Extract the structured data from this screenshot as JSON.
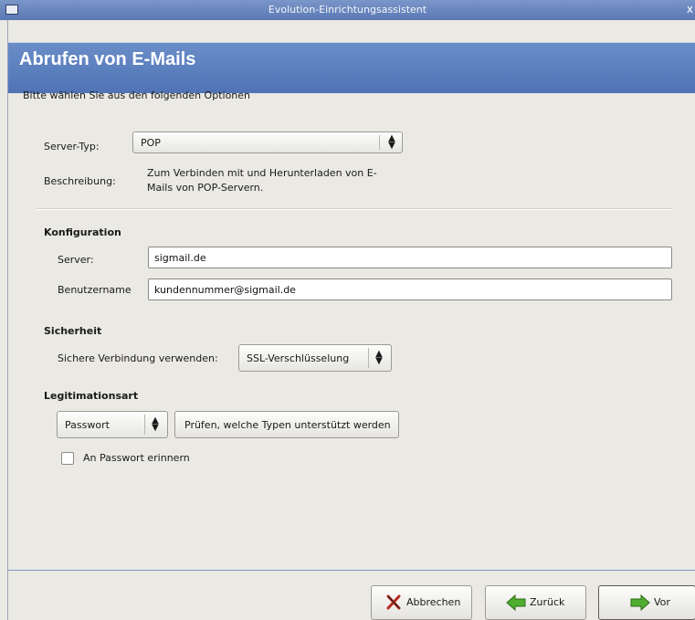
{
  "window": {
    "title": "Evolution-Einrichtungsassistent",
    "close_glyph": "x"
  },
  "header": {
    "title": "Abrufen von E-Mails"
  },
  "intro": "Bitte wählen Sie aus den folgenden Optionen",
  "server_type": {
    "label": "Server-Typ:",
    "value": "POP",
    "description_label": "Beschreibung:",
    "description": "Zum Verbinden mit und Herunterladen von E-Mails von POP-Servern."
  },
  "configuration": {
    "heading": "Konfiguration",
    "server_label": "Server:",
    "server_value": "sigmail.de",
    "username_label": "Benutzername",
    "username_value": "kundennummer@sigmail.de"
  },
  "security": {
    "heading": "Sicherheit",
    "label": "Sichere Verbindung verwenden:",
    "value": "SSL-Verschlüsselung"
  },
  "auth": {
    "heading": "Legitimationsart",
    "type_value": "Passwort",
    "check_button": "Prüfen, welche Typen unterstützt werden",
    "remember_label": "An Passwort erinnern",
    "remember_checked": false
  },
  "footer": {
    "cancel": "Abbrechen",
    "back": "Zurück",
    "forward": "Vor"
  },
  "icons": {
    "window": "mail-window-icon",
    "cancel": "cancel-x-icon",
    "back": "back-arrow-icon",
    "forward": "forward-arrow-icon",
    "combo": "updown-arrows-icon"
  },
  "colors": {
    "header": "#5a7fbe",
    "titlebar": "#6a87bf",
    "arrow_green": "#4eae2e"
  }
}
